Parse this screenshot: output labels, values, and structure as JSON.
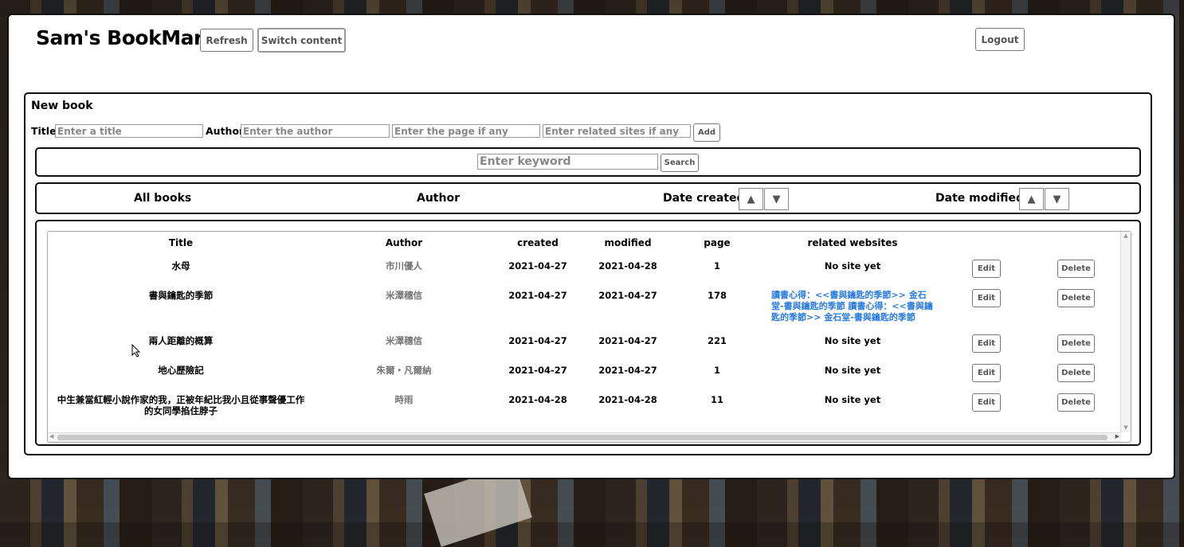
{
  "header": {
    "brand": "Sam's BookMark",
    "refresh": "Refresh",
    "switch": "Switch content",
    "logout": "Logout"
  },
  "new_book": {
    "title": "New book",
    "title_label": "Title",
    "author_label": "Author",
    "title_placeholder": "Enter a title",
    "author_placeholder": "Enter the author",
    "page_placeholder": "Enter the page if any",
    "sites_placeholder": "Enter related sites if any",
    "add": "Add"
  },
  "search": {
    "placeholder": "Enter keyword",
    "button": "Search"
  },
  "sort_bar": {
    "all_books": "All books",
    "author": "Author",
    "date_created": "Date created",
    "date_modified": "Date modified",
    "up": "▲",
    "down": "▼"
  },
  "table": {
    "columns": [
      "Title",
      "Author",
      "created",
      "modified",
      "page",
      "related websites"
    ],
    "edit": "Edit",
    "delete": "Delete",
    "rows": [
      {
        "title": "水母",
        "author": "市川優人",
        "created": "2021-04-27",
        "modified": "2021-04-28",
        "page": "1",
        "sites": "No site yet"
      },
      {
        "title": "書與鑰匙的季節",
        "author": "米澤穗信",
        "created": "2021-04-27",
        "modified": "2021-04-27",
        "page": "178",
        "sites": "讀書心得：<<書與鑰匙的季節>> 金石堂-書與鑰匙的季節 讀書心得：<<書與鑰匙的季節>> 金石堂-書與鑰匙的季節"
      },
      {
        "title": "兩人距離的概算",
        "author": "米澤穗信",
        "created": "2021-04-27",
        "modified": "2021-04-27",
        "page": "221",
        "sites": "No site yet"
      },
      {
        "title": "地心歷險記",
        "author": "朱爾・凡爾納",
        "created": "2021-04-27",
        "modified": "2021-04-27",
        "page": "1",
        "sites": "No site yet"
      },
      {
        "title": "中生兼當紅輕小說作家的我，正被年紀比我小且從事聲優工作的女同學掐住脖子",
        "author": "時雨",
        "created": "2021-04-28",
        "modified": "2021-04-28",
        "page": "11",
        "sites": "No site yet"
      }
    ]
  },
  "colors": {
    "link": "#2a7be0",
    "border": "#111111"
  }
}
